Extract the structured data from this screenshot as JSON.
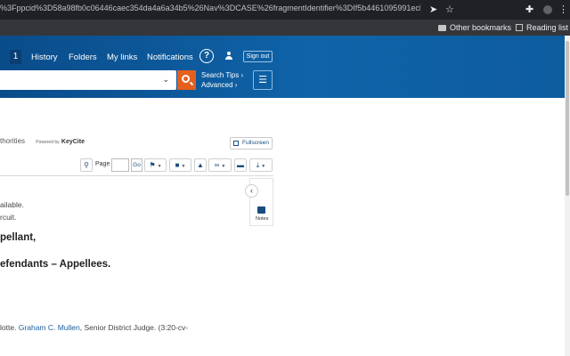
{
  "browser": {
    "url": "%3Fppcid%3D58a98fb0c06446caec354da4a6a34b5%26Nav%3DCASE%26fragmentIdentifier%3DIf5b4461095991ecb7ceee74f6b36648...",
    "bookmarks": [
      "Other bookmarks",
      "Reading list"
    ]
  },
  "header": {
    "nav_number": "1",
    "nav": [
      "History",
      "Folders",
      "My links",
      "Notifications"
    ],
    "help_label": "?",
    "sign_out": "Sign out",
    "search_placeholder": "",
    "search_tips": "Search Tips ›",
    "advanced": "Advanced ›"
  },
  "doc_header": {
    "authorities_tail": "thorities",
    "powered_by": "Powered by",
    "keycite": "KeyCite",
    "fullscreen": "Fullscreen"
  },
  "toolbar": {
    "page_label": "Page",
    "page_value": "",
    "go": "Go"
  },
  "side": {
    "notes_label": "Notes",
    "collapse": "‹"
  },
  "document": {
    "line1": "ailable.",
    "line2": "rcuit.",
    "party1": "pellant,",
    "party2": "efendants – Appellees.",
    "court_prefix": "lotte. ",
    "judge": "Graham C. Mullen",
    "court_suffix": ", Senior District Judge. (3:20-cv-"
  }
}
